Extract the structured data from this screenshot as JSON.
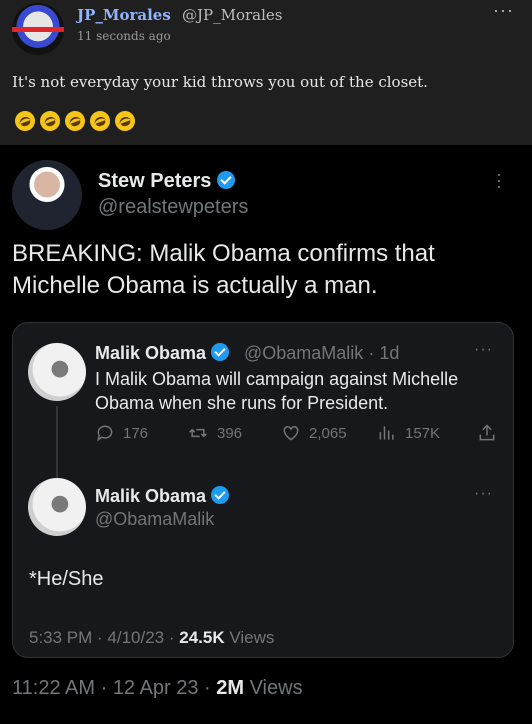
{
  "outer_post": {
    "display_name": "JP_Morales",
    "handle": "@JP_Morales",
    "timestamp": "11 seconds ago",
    "more_label": "···",
    "text": "It's not everyday your kid throws you out of the closet.",
    "emojis": [
      "rofl",
      "rofl",
      "rofl",
      "rofl",
      "rofl"
    ]
  },
  "tweet": {
    "display_name": "Stew Peters",
    "handle": "@realstewpeters",
    "text": "BREAKING: Malik Obama confirms that Michelle Obama is actually a man.",
    "timestamp": "11:22 AM",
    "date": "12 Apr 23",
    "views_count": "2M",
    "views_label": "Views"
  },
  "quoted_thread": {
    "parent": {
      "display_name": "Malik Obama",
      "handle": "@ObamaMalik",
      "age": "1d",
      "text": "I Malik Obama will campaign against Michelle Obama when she runs for President.",
      "replies": "176",
      "retweets": "396",
      "likes": "2,065",
      "views": "157K"
    },
    "reply": {
      "display_name": "Malik Obama",
      "handle": "@ObamaMalik",
      "text": "*He/She",
      "time": "5:33 PM",
      "date": "4/10/23",
      "views_count": "24.5K",
      "views_label": "Views"
    }
  },
  "colors": {
    "accent": "#1d9bf0",
    "muted": "#71767b",
    "outer_bg": "#1f1f1f",
    "name_link": "#8fb3ff"
  }
}
